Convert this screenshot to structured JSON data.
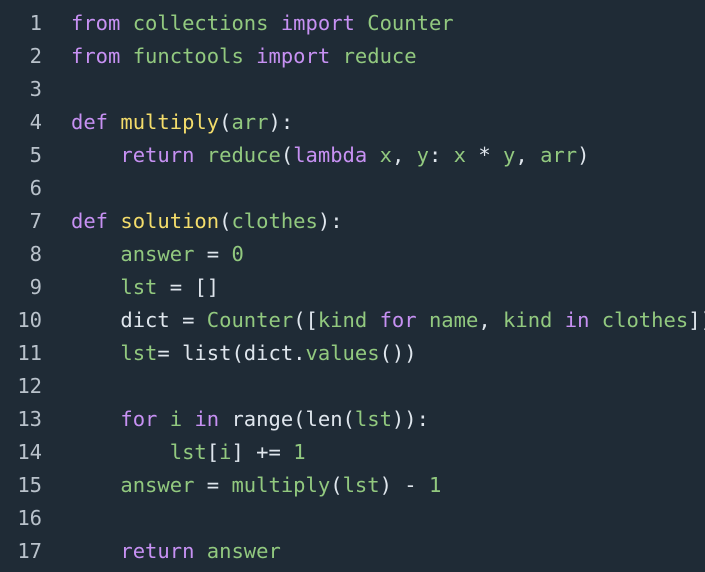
{
  "colors": {
    "background": "#1f2b36",
    "line_number": "#b9c2cb",
    "keyword": "#c791f3",
    "function_name": "#f4dd6b",
    "identifier": "#92c97f",
    "plain": "#dfe6ed"
  },
  "lines": [
    {
      "number": "1",
      "tokens": [
        {
          "t": "from",
          "c": "kw"
        },
        {
          "t": " "
        },
        {
          "t": "collections",
          "c": "gr"
        },
        {
          "t": " "
        },
        {
          "t": "import",
          "c": "kw"
        },
        {
          "t": " "
        },
        {
          "t": "Counter",
          "c": "gr"
        }
      ]
    },
    {
      "number": "2",
      "tokens": [
        {
          "t": "from",
          "c": "kw"
        },
        {
          "t": " "
        },
        {
          "t": "functools",
          "c": "gr"
        },
        {
          "t": " "
        },
        {
          "t": "import",
          "c": "kw"
        },
        {
          "t": " "
        },
        {
          "t": "reduce",
          "c": "gr"
        }
      ]
    },
    {
      "number": "3",
      "tokens": []
    },
    {
      "number": "4",
      "tokens": [
        {
          "t": "def",
          "c": "kw"
        },
        {
          "t": " "
        },
        {
          "t": "multiply",
          "c": "fn"
        },
        {
          "t": "(",
          "c": "pl"
        },
        {
          "t": "arr",
          "c": "gr"
        },
        {
          "t": "):",
          "c": "pl"
        }
      ]
    },
    {
      "number": "5",
      "tokens": [
        {
          "t": "    "
        },
        {
          "t": "return",
          "c": "kw"
        },
        {
          "t": " "
        },
        {
          "t": "reduce",
          "c": "gr"
        },
        {
          "t": "(",
          "c": "pl"
        },
        {
          "t": "lambda",
          "c": "kw"
        },
        {
          "t": " "
        },
        {
          "t": "x",
          "c": "gr"
        },
        {
          "t": ", ",
          "c": "pl"
        },
        {
          "t": "y",
          "c": "gr"
        },
        {
          "t": ": ",
          "c": "pl"
        },
        {
          "t": "x",
          "c": "gr"
        },
        {
          "t": " * ",
          "c": "pl"
        },
        {
          "t": "y",
          "c": "gr"
        },
        {
          "t": ", ",
          "c": "pl"
        },
        {
          "t": "arr",
          "c": "gr"
        },
        {
          "t": ")",
          "c": "pl"
        }
      ]
    },
    {
      "number": "6",
      "tokens": []
    },
    {
      "number": "7",
      "tokens": [
        {
          "t": "def",
          "c": "kw"
        },
        {
          "t": " "
        },
        {
          "t": "solution",
          "c": "fn"
        },
        {
          "t": "(",
          "c": "pl"
        },
        {
          "t": "clothes",
          "c": "gr"
        },
        {
          "t": "):",
          "c": "pl"
        }
      ]
    },
    {
      "number": "8",
      "tokens": [
        {
          "t": "    "
        },
        {
          "t": "answer",
          "c": "gr"
        },
        {
          "t": " = ",
          "c": "pl"
        },
        {
          "t": "0",
          "c": "gr"
        }
      ]
    },
    {
      "number": "9",
      "tokens": [
        {
          "t": "    "
        },
        {
          "t": "lst",
          "c": "gr"
        },
        {
          "t": " = []",
          "c": "pl"
        }
      ]
    },
    {
      "number": "10",
      "tokens": [
        {
          "t": "    "
        },
        {
          "t": "dict",
          "c": "pl"
        },
        {
          "t": " = ",
          "c": "pl"
        },
        {
          "t": "Counter",
          "c": "gr"
        },
        {
          "t": "([",
          "c": "pl"
        },
        {
          "t": "kind",
          "c": "gr"
        },
        {
          "t": " "
        },
        {
          "t": "for",
          "c": "kw"
        },
        {
          "t": " "
        },
        {
          "t": "name",
          "c": "gr"
        },
        {
          "t": ", ",
          "c": "pl"
        },
        {
          "t": "kind",
          "c": "gr"
        },
        {
          "t": " "
        },
        {
          "t": "in",
          "c": "kw"
        },
        {
          "t": " "
        },
        {
          "t": "clothes",
          "c": "gr"
        },
        {
          "t": "])",
          "c": "pl"
        }
      ]
    },
    {
      "number": "11",
      "tokens": [
        {
          "t": "    "
        },
        {
          "t": "lst",
          "c": "gr"
        },
        {
          "t": "= list(dict.",
          "c": "pl"
        },
        {
          "t": "values",
          "c": "gr"
        },
        {
          "t": "())",
          "c": "pl"
        }
      ]
    },
    {
      "number": "12",
      "tokens": []
    },
    {
      "number": "13",
      "tokens": [
        {
          "t": "    "
        },
        {
          "t": "for",
          "c": "kw"
        },
        {
          "t": " "
        },
        {
          "t": "i",
          "c": "gr"
        },
        {
          "t": " "
        },
        {
          "t": "in",
          "c": "kw"
        },
        {
          "t": " range(len(",
          "c": "pl"
        },
        {
          "t": "lst",
          "c": "gr"
        },
        {
          "t": ")):",
          "c": "pl"
        }
      ]
    },
    {
      "number": "14",
      "tokens": [
        {
          "t": "        "
        },
        {
          "t": "lst",
          "c": "gr"
        },
        {
          "t": "[",
          "c": "pl"
        },
        {
          "t": "i",
          "c": "gr"
        },
        {
          "t": "] += ",
          "c": "pl"
        },
        {
          "t": "1",
          "c": "gr"
        }
      ]
    },
    {
      "number": "15",
      "tokens": [
        {
          "t": "    "
        },
        {
          "t": "answer",
          "c": "gr"
        },
        {
          "t": " = ",
          "c": "pl"
        },
        {
          "t": "multiply",
          "c": "gr"
        },
        {
          "t": "(",
          "c": "pl"
        },
        {
          "t": "lst",
          "c": "gr"
        },
        {
          "t": ") - ",
          "c": "pl"
        },
        {
          "t": "1",
          "c": "gr"
        }
      ]
    },
    {
      "number": "16",
      "tokens": []
    },
    {
      "number": "17",
      "tokens": [
        {
          "t": "    "
        },
        {
          "t": "return",
          "c": "kw"
        },
        {
          "t": " "
        },
        {
          "t": "answer",
          "c": "gr"
        }
      ]
    }
  ]
}
